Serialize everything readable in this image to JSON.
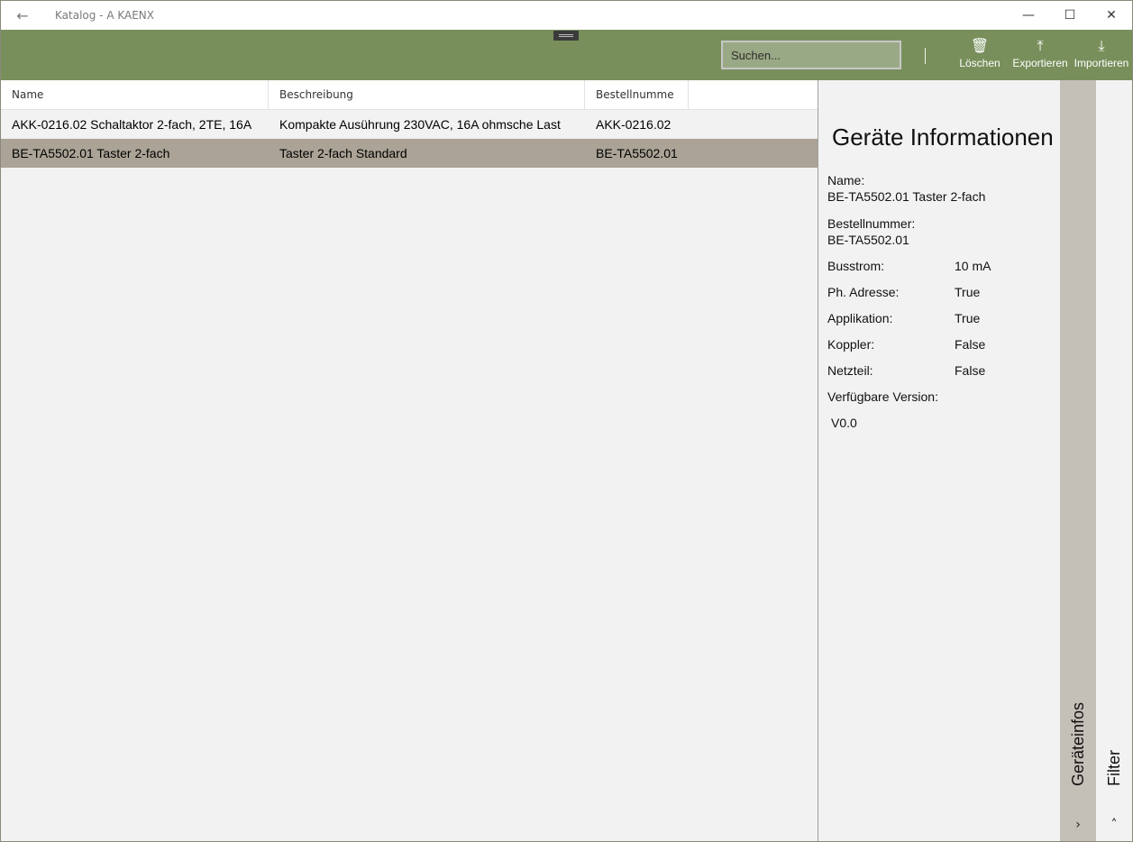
{
  "titlebar": {
    "back_icon": "←",
    "title": "Katalog - A KAENX",
    "min_icon": "—",
    "max_icon": "☐",
    "close_icon": "✕"
  },
  "toolbar": {
    "search_placeholder": "Suchen...",
    "delete": {
      "label": "Löschen",
      "icon": "🗑"
    },
    "export": {
      "label": "Exportieren",
      "icon": "⤒"
    },
    "import": {
      "label": "Importieren",
      "icon": "⤓"
    }
  },
  "table": {
    "columns": [
      "Name",
      "Beschreibung",
      "Bestellnumme"
    ],
    "rows": [
      {
        "name": "AKK-0216.02 Schaltaktor 2-fach, 2TE, 16A",
        "description": "Kompakte Ausührung 230VAC, 16A ohmsche Last",
        "order": "AKK-0216.02",
        "selected": false
      },
      {
        "name": "BE-TA5502.01 Taster 2-fach",
        "description": "Taster 2-fach Standard",
        "order": "BE-TA5502.01",
        "selected": true
      }
    ]
  },
  "info": {
    "heading": "Geräte Informationen",
    "name_label": "Name:",
    "name_value": "BE-TA5502.01 Taster 2-fach",
    "order_label": "Bestellnummer:",
    "order_value": "BE-TA5502.01",
    "busstrom_label": "Busstrom:",
    "busstrom_value": "10  mA",
    "phaddr_label": "Ph. Adresse:",
    "phaddr_value": "True",
    "app_label": "Applikation:",
    "app_value": "True",
    "koppler_label": "Koppler:",
    "koppler_value": "False",
    "netzteil_label": "Netzteil:",
    "netzteil_value": "False",
    "version_label": "Verfügbare Version:",
    "version_value": "V0.0"
  },
  "sidetabs": {
    "geraeteinfos": "Geräteinfos",
    "filter": "Filter",
    "chevron_right": "›",
    "chevron_up": "˄"
  }
}
